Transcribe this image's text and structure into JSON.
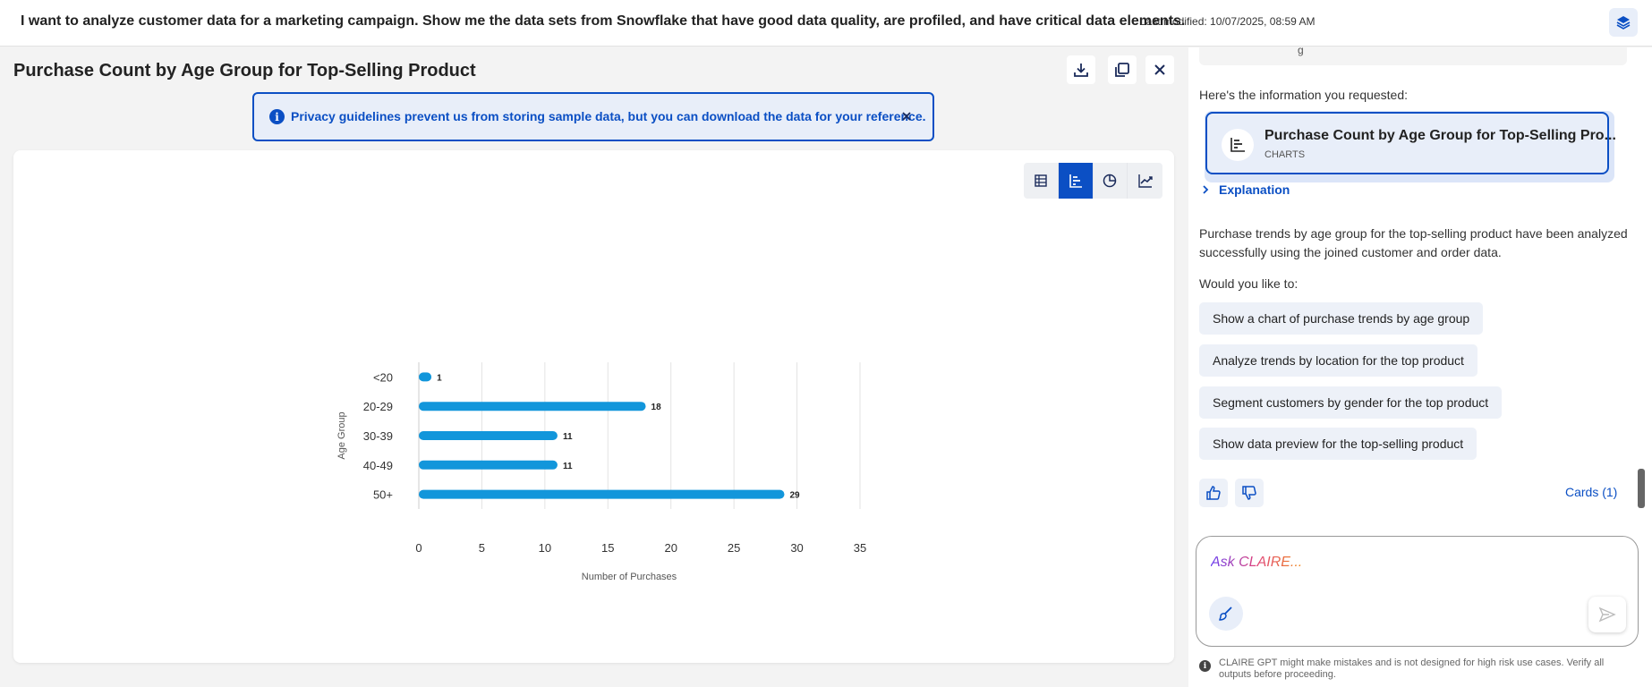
{
  "header": {
    "prompt": "I want to analyze customer data for a marketing campaign. Show me the data sets from Snowflake that have good data quality, are profiled, and have critical data elements.",
    "last_modified": "Last modified: 10/07/2025, 08:59 AM"
  },
  "left_panel": {
    "title": "Purchase Count by Age Group for Top-Selling Product",
    "toolbar_icons": [
      "download-icon",
      "copy-icon",
      "close-icon"
    ],
    "banner": {
      "text": "Privacy guidelines prevent us from storing sample data, but you can download the data for your reference."
    },
    "view_options": [
      "table-icon",
      "bar-chart-icon",
      "pie-chart-icon",
      "line-chart-icon"
    ],
    "active_view": "bar"
  },
  "chart_data": {
    "type": "bar",
    "orientation": "horizontal",
    "categories": [
      "<20",
      "20-29",
      "30-39",
      "40-49",
      "50+"
    ],
    "values": [
      1,
      18,
      11,
      11,
      29
    ],
    "data_labels": [
      "1",
      "18",
      "11",
      "11",
      "29"
    ],
    "xlabel": "Number of Purchases",
    "ylabel": "Age Group",
    "xlim": [
      0,
      35
    ],
    "xticks": [
      "0",
      "5",
      "10",
      "15",
      "20",
      "25",
      "30",
      "35"
    ],
    "grid": "vertical",
    "bar_color": "#1296db"
  },
  "right_panel": {
    "previous_card_fragment": "g",
    "info_requested": "Here's the information you requested:",
    "result_card": {
      "title": "Purchase Count by Age Group for Top-Selling Pro...",
      "subtitle": "CHARTS"
    },
    "explanation_label": "Explanation",
    "summary": "Purchase trends by age group for the top-selling product have been analyzed successfully using the joined customer and order data.",
    "would_you_like": "Would you like to:",
    "suggestions": [
      "Show a chart of purchase trends by age group",
      "Analyze trends by location for the top product",
      "Segment customers by gender for the top product",
      "Show data preview for the top-selling product"
    ],
    "cards_link": "Cards (1)",
    "ask_placeholder": "Ask CLAIRE...",
    "disclaimer": "CLAIRE GPT might make mistakes and is not designed for high risk use cases. Verify all outputs before proceeding."
  },
  "colors": {
    "accent": "#0b4fc4",
    "bar": "#1296db",
    "banner_bg": "#e8eef9"
  }
}
